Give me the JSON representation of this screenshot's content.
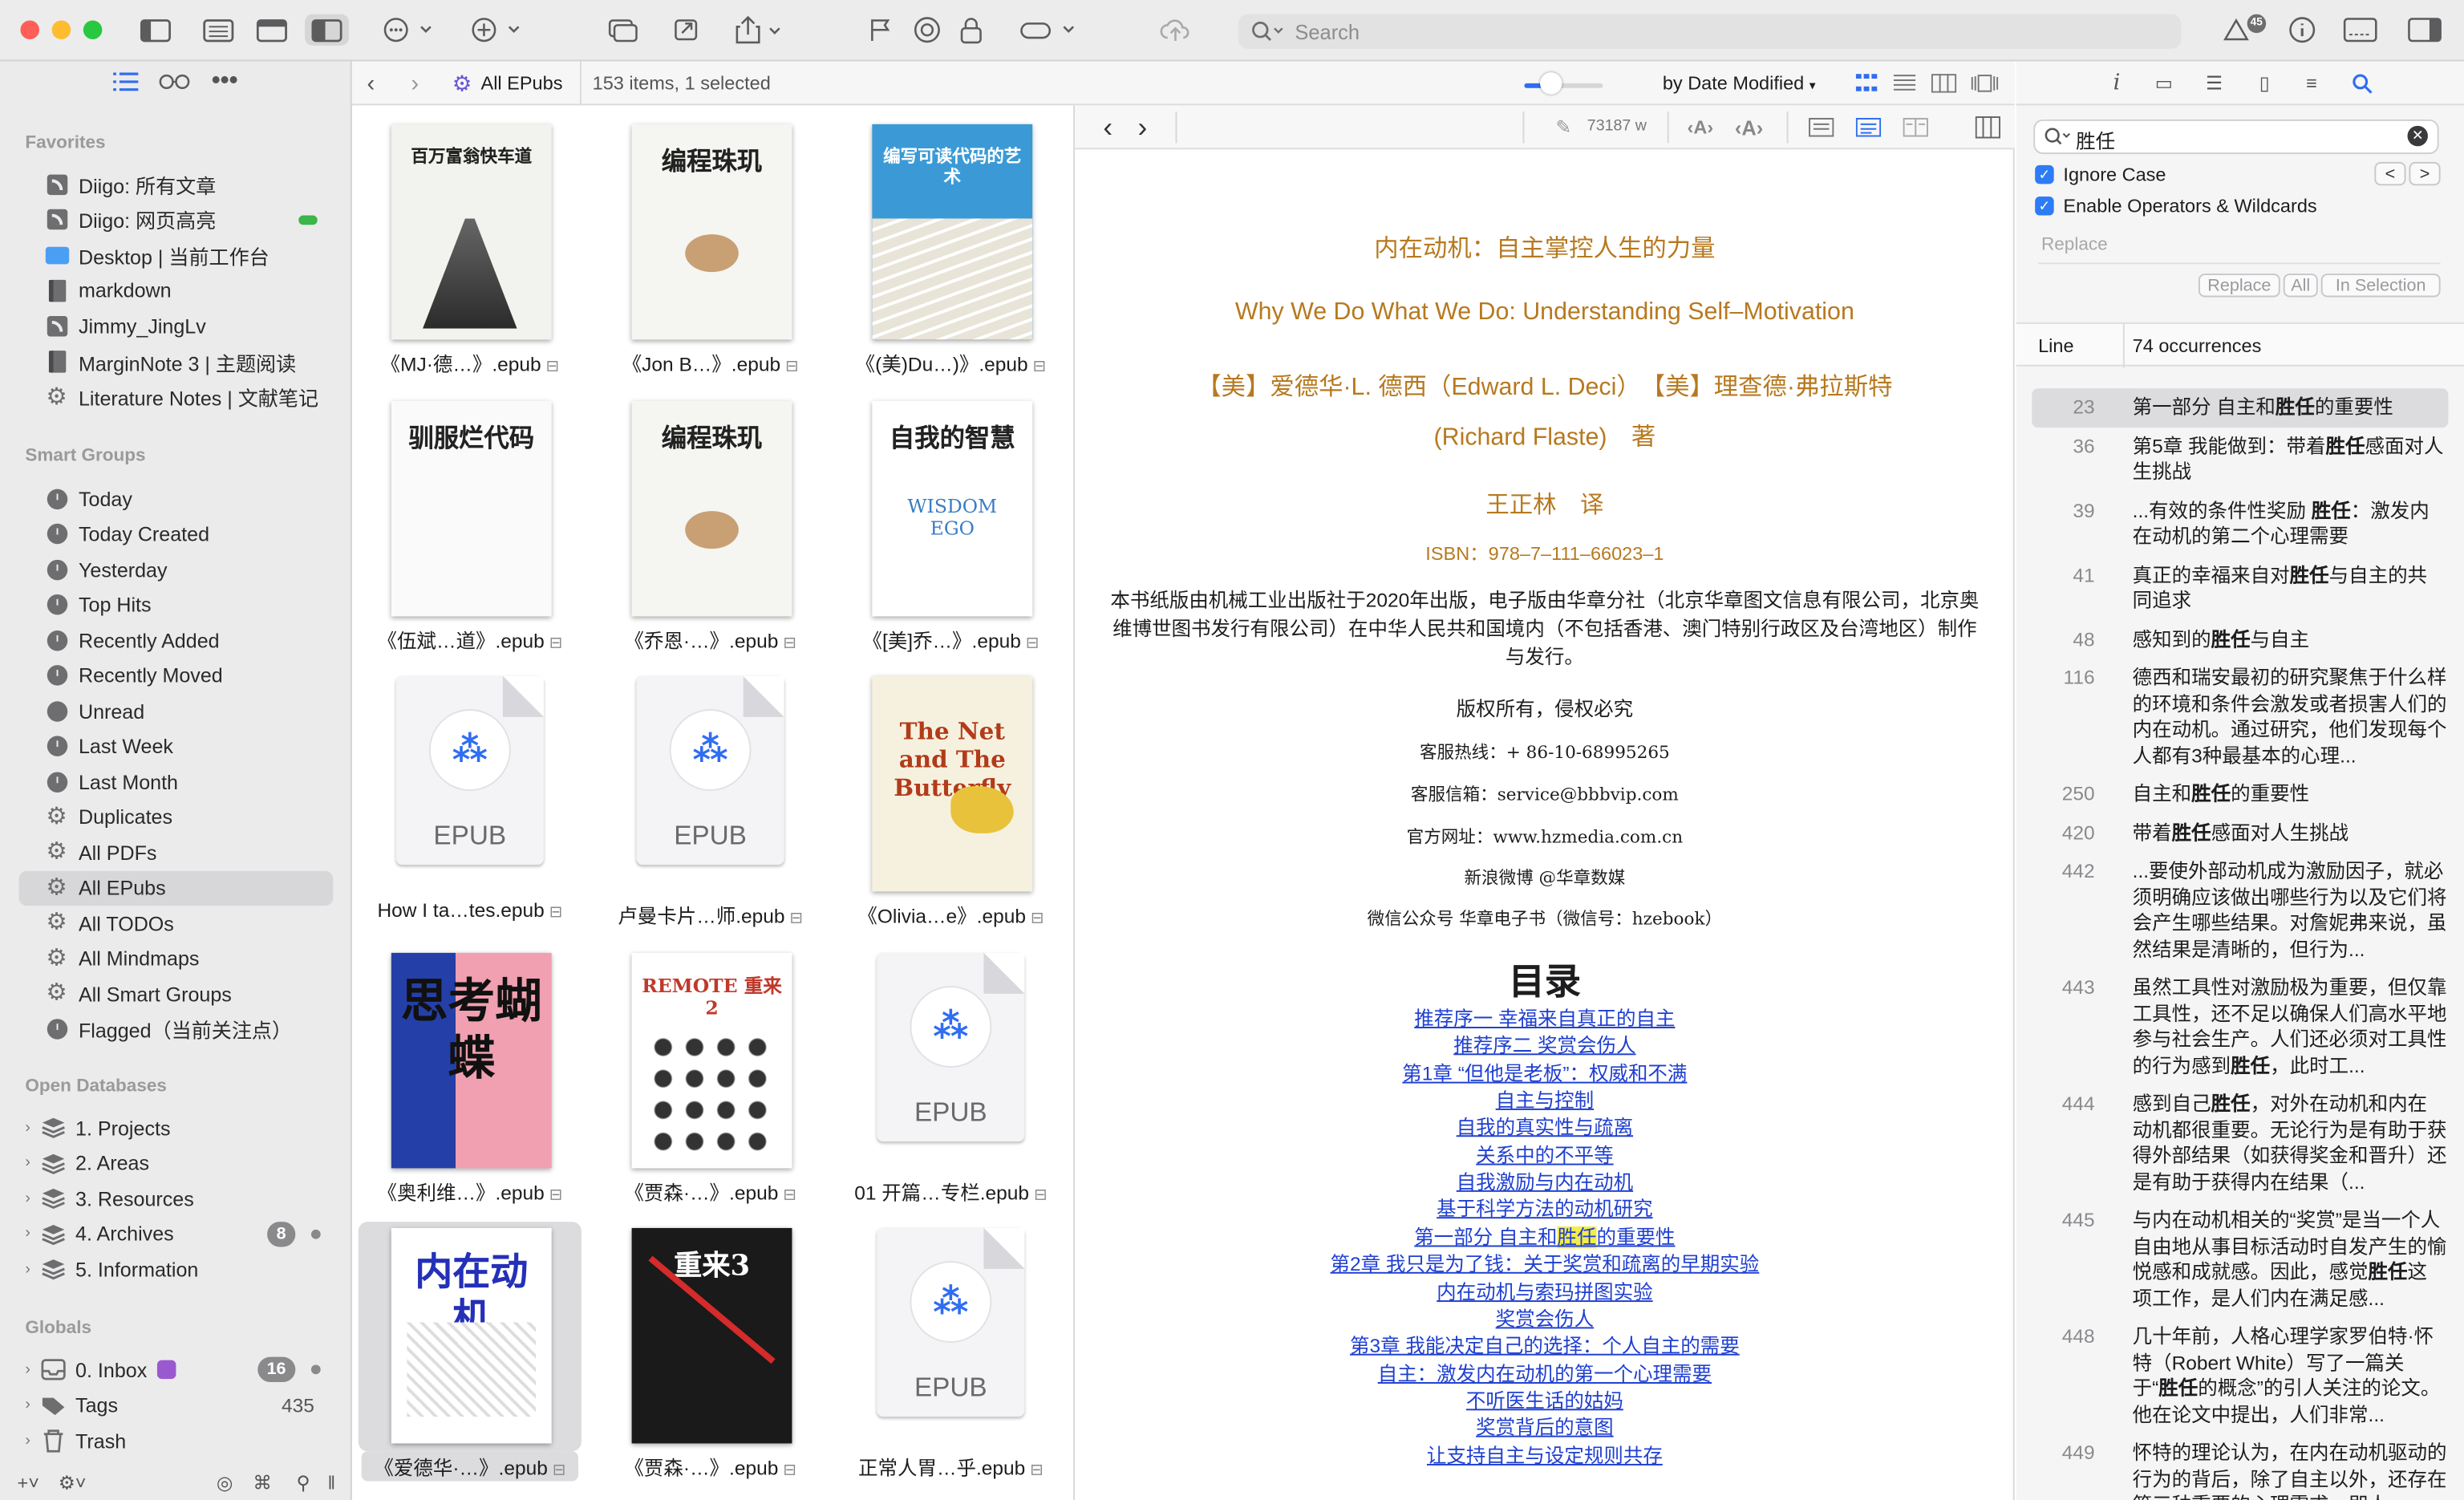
{
  "toolbar": {
    "search_placeholder": "Search",
    "badge_count": "45"
  },
  "sidebar": {
    "favorites_title": "Favorites",
    "favorites": [
      {
        "label": "Diigo: 所有文章",
        "icon": "rss-feed-icon"
      },
      {
        "label": "Diigo: 网页高亮",
        "icon": "rss-feed-icon"
      },
      {
        "label": "Desktop | 当前工作台",
        "icon": "folder-icon"
      },
      {
        "label": "markdown",
        "icon": "notebook-icon"
      },
      {
        "label": "Jimmy_JingLv",
        "icon": "rss-feed-icon"
      },
      {
        "label": "MarginNote 3 | 主题阅读",
        "icon": "notebook-icon"
      },
      {
        "label": "Literature Notes | 文献笔记",
        "icon": "gear-icon"
      }
    ],
    "smart_title": "Smart Groups",
    "smart": [
      {
        "label": "Today",
        "icon": "clock-icon"
      },
      {
        "label": "Today Created",
        "icon": "clock-icon"
      },
      {
        "label": "Yesterday",
        "icon": "clock-icon"
      },
      {
        "label": "Top Hits",
        "icon": "clock-icon"
      },
      {
        "label": "Recently Added",
        "icon": "clock-icon"
      },
      {
        "label": "Recently Moved",
        "icon": "clock-icon"
      },
      {
        "label": "Unread",
        "icon": "circle-icon"
      },
      {
        "label": "Last Week",
        "icon": "clock-icon"
      },
      {
        "label": "Last Month",
        "icon": "clock-icon"
      },
      {
        "label": "Duplicates",
        "icon": "gear-icon"
      },
      {
        "label": "All PDFs",
        "icon": "gear-icon"
      },
      {
        "label": "All EPubs",
        "icon": "gear-icon"
      },
      {
        "label": "All TODOs",
        "icon": "gear-icon"
      },
      {
        "label": "All Mindmaps",
        "icon": "gear-icon"
      },
      {
        "label": "All Smart Groups",
        "icon": "gear-icon"
      },
      {
        "label": "Flagged（当前关注点）",
        "icon": "clock-icon"
      }
    ],
    "open_title": "Open Databases",
    "open": [
      {
        "label": "1. Projects",
        "badge": ""
      },
      {
        "label": "2. Areas",
        "badge": ""
      },
      {
        "label": "3. Resources",
        "badge": ""
      },
      {
        "label": "4. Archives",
        "badge": "8"
      },
      {
        "label": "5. Information",
        "badge": ""
      }
    ],
    "globals_title": "Globals",
    "globals": [
      {
        "label": "0. Inbox",
        "badge": "16",
        "icon": "inbox-icon"
      },
      {
        "label": "Tags",
        "count": "435",
        "icon": "tag-icon"
      },
      {
        "label": "Trash",
        "icon": "trash-icon"
      }
    ]
  },
  "browser": {
    "group_label": "All EPubs",
    "status": "153 items, 1 selected",
    "sort_label": "by Date Modified",
    "items": [
      {
        "caption": "《MJ·德…》.epub",
        "cover": {
          "title": "百万富翁快车道",
          "bg": "#f2f2ee"
        }
      },
      {
        "caption": "《Jon B…》.epub",
        "cover": {
          "title": "编程珠玑",
          "bg": "#f5f5f2"
        }
      },
      {
        "caption": "《(美)Du…)》.epub",
        "cover": {
          "title": "编写可读代码的艺术",
          "bg": "#3b9ad6"
        }
      },
      {
        "caption": "《伍斌…道》.epub",
        "cover": {
          "title": "驯服烂代码",
          "bg": "#fafafa"
        }
      },
      {
        "caption": "《乔恩·…》.epub",
        "cover": {
          "title": "编程珠玑",
          "bg": "#f5f5f2"
        }
      },
      {
        "caption": "《[美]乔…》.epub",
        "cover": {
          "title": "自我的智慧",
          "bg": "#ffffff"
        }
      },
      {
        "caption": "How I ta…tes.epub",
        "epub": "EPUB"
      },
      {
        "caption": "卢曼卡片…师.epub",
        "epub": "EPUB"
      },
      {
        "caption": "《Olivia…e》.epub",
        "cover": {
          "title": "The Net and The Butterfly",
          "bg": "#f6f1df"
        }
      },
      {
        "caption": "《奥利维…》.epub",
        "cover": {
          "title": "思考蝴蝶",
          "bg": "#2440a8"
        }
      },
      {
        "caption": "《贾森·…》.epub",
        "cover": {
          "title": "REMOTE 重来2",
          "bg": "#ffffff"
        }
      },
      {
        "caption": "01 开篇…专栏.epub",
        "epub": "EPUB"
      },
      {
        "caption": "《爱德华·…》.epub",
        "cover": {
          "title": "内在动机",
          "bg": "#ffffff"
        },
        "selected": true
      },
      {
        "caption": "《贾森·…》.epub",
        "cover": {
          "title": "重来3",
          "bg": "#1a1a1a"
        }
      },
      {
        "caption": "正常人胃…乎.epub",
        "epub": "EPUB"
      }
    ]
  },
  "reader": {
    "word_count": "73187 w",
    "title_cn": "内在动机：自主掌控人生的力量",
    "title_en": "Why We Do What We Do: Understanding Self–Motivation",
    "authors_1": "【美】爱德华·L. 德西（Edward L. Deci）　【美】理查德·弗拉斯特",
    "authors_2": "(Richard Flaste)　著",
    "translator": "王正林　译",
    "isbn": "ISBN：978–7–111–66023–1",
    "pub_1": "本书纸版由机械工业出版社于2020年出版，电子版由华章分社（北京华章图文信息有限公司，北京奥",
    "pub_2": "维博世图书发行有限公司）在中华人民共和国境内（不包括香港、澳门特别行政区及台湾地区）制作",
    "pub_3": "与发行。",
    "rights": "版权所有，侵权必究",
    "hotline": "客服热线：+ 86-10-68995265",
    "email": "客服信箱：service@bbbvip.com",
    "website": "官方网址：www.hzmedia.com.cn",
    "weibo": "新浪微博 @华章数媒",
    "wechat": "微信公众号 华章电子书（微信号：hzebook）",
    "toc_title": "目录",
    "toc": [
      "推荐序一 幸福来自真正的自主",
      "推荐序二 奖赏会伤人",
      "第1章 “但他是老板”：权威和不满",
      "自主与控制",
      "自我的真实性与疏离",
      "关系中的不平等",
      "自我激励与内在动机",
      "基于科学方法的动机研究",
      "第一部分 自主和胜任的重要性",
      "第2章 我只是为了钱：关于奖赏和疏离的早期实验",
      "内在动机与索玛拼图实验",
      "奖赏会伤人",
      "第3章 我能决定自己的选择：个人自主的需要",
      "自主：激发内在动机的第一个心理需要",
      "不听医生话的姑妈",
      "奖赏背后的意图",
      "让支持自主与设定规则共存"
    ],
    "toc_highlight_pre": "第一部分 自主和",
    "toc_highlight_word": "胜任",
    "toc_highlight_post": "的重要性"
  },
  "inspector": {
    "search_value": "胜任",
    "ignore_case": "Ignore Case",
    "operators": "Enable Operators & Wildcards",
    "replace_placeholder": "Replace",
    "btn_replace": "Replace",
    "btn_all": "All",
    "btn_in_selection": "In Selection",
    "col_line": "Line",
    "occurrences": "74 occurrences",
    "results": [
      {
        "line": "23",
        "text": "第一部分 自主和胜任的重要性"
      },
      {
        "line": "36",
        "text": "第5章 我能做到：带着胜任感面对人生挑战"
      },
      {
        "line": "39",
        "text": "...有效的条件性奖励 胜任：激发内在动机的第二个心理需要"
      },
      {
        "line": "41",
        "text": "真正的幸福来自对胜任与自主的共同追求"
      },
      {
        "line": "48",
        "text": "感知到的胜任与自主"
      },
      {
        "line": "116",
        "text": "德西和瑞安最初的研究聚焦于什么样的环境和条件会激发或者损害人们的内在动机。通过研究，他们发现每个人都有3种最基本的心理..."
      },
      {
        "line": "250",
        "text": "自主和胜任的重要性"
      },
      {
        "line": "420",
        "text": "带着胜任感面对人生挑战"
      },
      {
        "line": "442",
        "text": "...要使外部动机成为激励因子，就必须明确应该做出哪些行为以及它们将会产生哪些结果。对詹妮弗来说，虽然结果是清晰的，但行为..."
      },
      {
        "line": "443",
        "text": "虽然工具性对激励极为重要，但仅靠工具性，还不足以确保人们高水平地参与社会生产。人们还必须对工具性的行为感到胜任，此时工..."
      },
      {
        "line": "444",
        "text": "感到自己胜任，对外在动机和内在动机都很重要。无论行为是有助于获得外部结果（如获得奖金和晋升）还是有助于获得内在结果（..."
      },
      {
        "line": "445",
        "text": "与内在动机相关的“奖赏”是当一个人自由地从事目标活动时自发产生的愉悦感和成就感。因此，感觉胜任这项工作，是人们内在满足感..."
      },
      {
        "line": "448",
        "text": "几十年前，人格心理学家罗伯特·怀特（Robert White）写了一篇关于“胜任的概念”的引人关注的论文。他在论文中提出，人们非常..."
      },
      {
        "line": "449",
        "text": "怀特的理论认为，在内在动机驱动的行为的背后，除了自主以外，还存在第三种重要的心理需求，即人..."
      }
    ]
  }
}
